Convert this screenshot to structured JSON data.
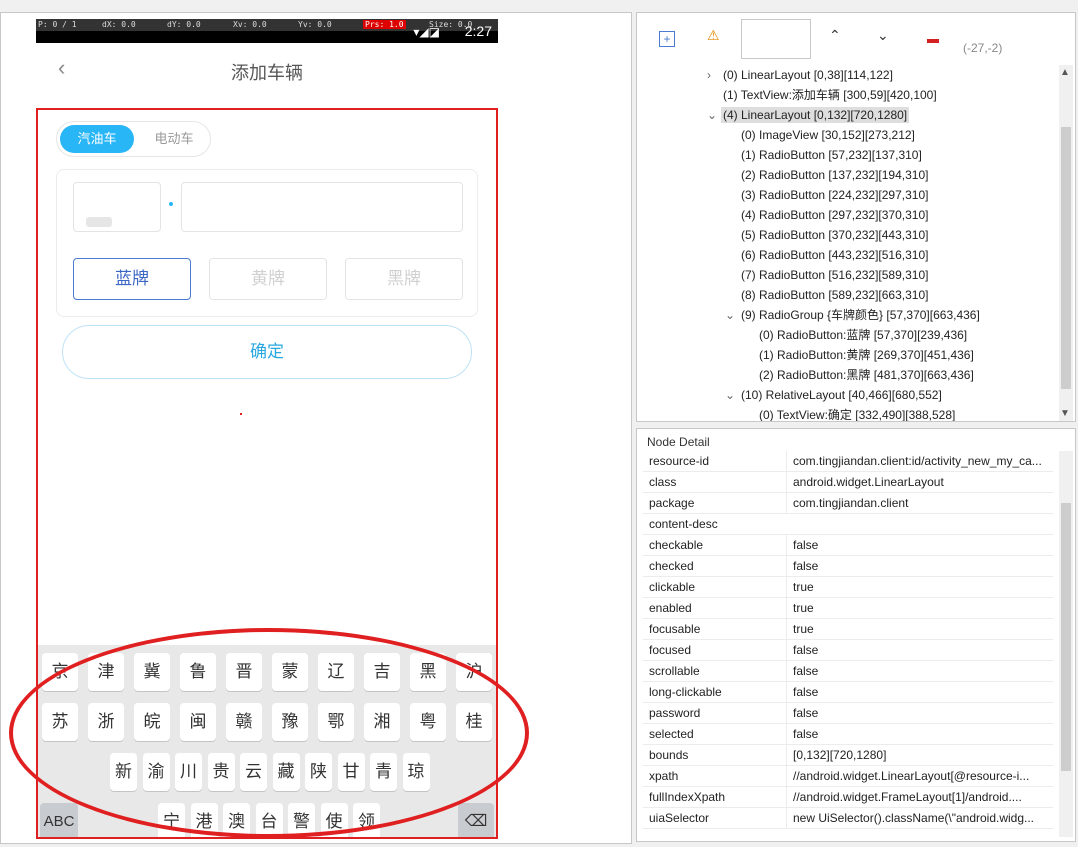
{
  "device": {
    "pointer": {
      "p": "P: 0 / 1",
      "dx": "dX: 0.0",
      "dy": "dY: 0.0",
      "xv": "Xv: 0.0",
      "yv": "Yv: 0.0",
      "prs": "Prs: 1.0",
      "size": "Size: 0.0"
    },
    "status_icons": "▾◢◪",
    "clock": "2:27"
  },
  "app": {
    "back_icon": "‹",
    "title": "添加车辆",
    "tabs": [
      "汽油车",
      "电动车"
    ],
    "plate_colors": [
      "蓝牌",
      "黄牌",
      "黑牌"
    ],
    "confirm": "确定",
    "keyboard": {
      "row1": [
        "京",
        "津",
        "冀",
        "鲁",
        "晋",
        "蒙",
        "辽",
        "吉",
        "黑",
        "沪"
      ],
      "row2": [
        "苏",
        "浙",
        "皖",
        "闽",
        "赣",
        "豫",
        "鄂",
        "湘",
        "粤",
        "桂"
      ],
      "row3": [
        "新",
        "渝",
        "川",
        "贵",
        "云",
        "藏",
        "陕",
        "甘",
        "青",
        "琼"
      ],
      "row4": [
        "宁",
        "港",
        "澳",
        "台",
        "警",
        "使",
        "领"
      ],
      "abc": "ABC",
      "delete": "⌫"
    }
  },
  "toolbar": {
    "coords": "(-27,-2)"
  },
  "tree": {
    "nodes": [
      {
        "twisty": "›",
        "text": "(0) LinearLayout [0,38][114,122]"
      },
      {
        "twisty": "",
        "text": "(1) TextView:添加车辆 [300,59][420,100]"
      },
      {
        "twisty": "⌄",
        "text": "(4) LinearLayout [0,132][720,1280]"
      },
      {
        "twisty": "",
        "text": "(0) ImageView [30,152][273,212]"
      },
      {
        "twisty": "",
        "text": "(1) RadioButton [57,232][137,310]"
      },
      {
        "twisty": "",
        "text": "(2) RadioButton [137,232][194,310]"
      },
      {
        "twisty": "",
        "text": "(3) RadioButton [224,232][297,310]"
      },
      {
        "twisty": "",
        "text": "(4) RadioButton [297,232][370,310]"
      },
      {
        "twisty": "",
        "text": "(5) RadioButton [370,232][443,310]"
      },
      {
        "twisty": "",
        "text": "(6) RadioButton [443,232][516,310]"
      },
      {
        "twisty": "",
        "text": "(7) RadioButton [516,232][589,310]"
      },
      {
        "twisty": "",
        "text": "(8) RadioButton [589,232][663,310]"
      },
      {
        "twisty": "⌄",
        "text": "(9) RadioGroup {车牌颜色} [57,370][663,436]"
      },
      {
        "twisty": "",
        "text": "(0) RadioButton:蓝牌 [57,370][239,436]"
      },
      {
        "twisty": "",
        "text": "(1) RadioButton:黄牌 [269,370][451,436]"
      },
      {
        "twisty": "",
        "text": "(2) RadioButton:黑牌 [481,370][663,436]"
      },
      {
        "twisty": "⌄",
        "text": "(10) RelativeLayout [40,466][680,552]"
      },
      {
        "twisty": "",
        "text": "(0) TextView:确定 [332,490][388,528]"
      }
    ]
  },
  "detail": {
    "title": "Node Detail",
    "rows": [
      {
        "key": "resource-id",
        "value": "com.tingjiandan.client:id/activity_new_my_ca..."
      },
      {
        "key": "class",
        "value": "android.widget.LinearLayout"
      },
      {
        "key": "package",
        "value": "com.tingjiandan.client"
      },
      {
        "key": "content-desc",
        "value": ""
      },
      {
        "key": "checkable",
        "value": "false"
      },
      {
        "key": "checked",
        "value": "false"
      },
      {
        "key": "clickable",
        "value": "true"
      },
      {
        "key": "enabled",
        "value": "true"
      },
      {
        "key": "focusable",
        "value": "true"
      },
      {
        "key": "focused",
        "value": "false"
      },
      {
        "key": "scrollable",
        "value": "false"
      },
      {
        "key": "long-clickable",
        "value": "false"
      },
      {
        "key": "password",
        "value": "false"
      },
      {
        "key": "selected",
        "value": "false"
      },
      {
        "key": "bounds",
        "value": "[0,132][720,1280]"
      },
      {
        "key": "xpath",
        "value": "//android.widget.LinearLayout[@resource-i..."
      },
      {
        "key": "fullIndexXpath",
        "value": "//android.widget.FrameLayout[1]/android...."
      },
      {
        "key": "uiaSelector",
        "value": "new UiSelector().className(\\\"android.widg..."
      }
    ]
  }
}
